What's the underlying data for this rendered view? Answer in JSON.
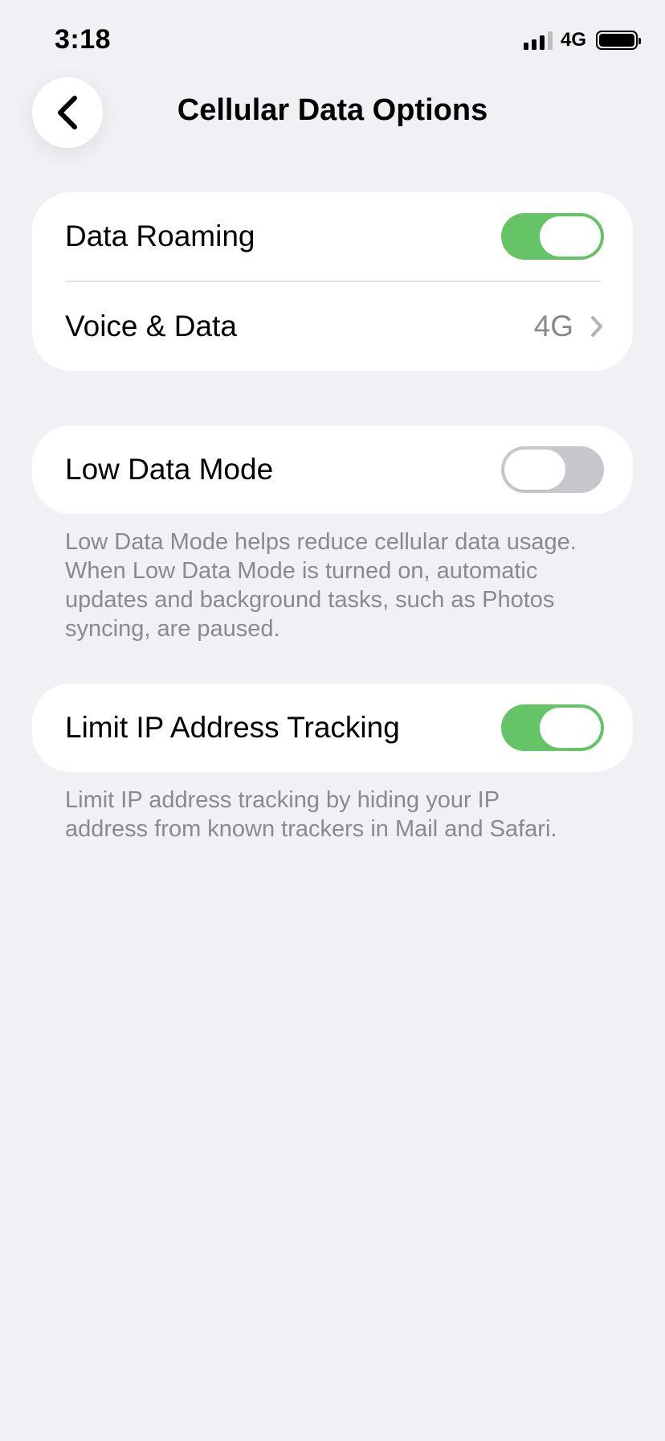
{
  "status_bar": {
    "time": "3:18",
    "network": "4G",
    "signal_icon": "cellular-signal-icon",
    "battery_icon": "battery-icon"
  },
  "nav": {
    "back_icon": "chevron-left-icon",
    "title": "Cellular Data Options"
  },
  "sections": {
    "roaming_group": {
      "data_roaming": {
        "label": "Data Roaming",
        "toggle_on": true
      },
      "voice_data": {
        "label": "Voice & Data",
        "value": "4G",
        "chevron_icon": "chevron-right-icon"
      }
    },
    "low_data": {
      "label": "Low Data Mode",
      "toggle_on": false,
      "footnote": "Low Data Mode helps reduce cellular data usage. When Low Data Mode is turned on, automatic updates and background tasks, such as Photos syncing, are paused."
    },
    "limit_ip": {
      "label": "Limit IP Address Tracking",
      "toggle_on": true,
      "footnote": "Limit IP address tracking by hiding your IP address from known trackers in Mail and Safari."
    }
  },
  "colors": {
    "background": "#F0F0F5",
    "toggle_on": "#65C466",
    "toggle_off": "#C8C8CC",
    "secondary_text": "#8A8A8E"
  }
}
